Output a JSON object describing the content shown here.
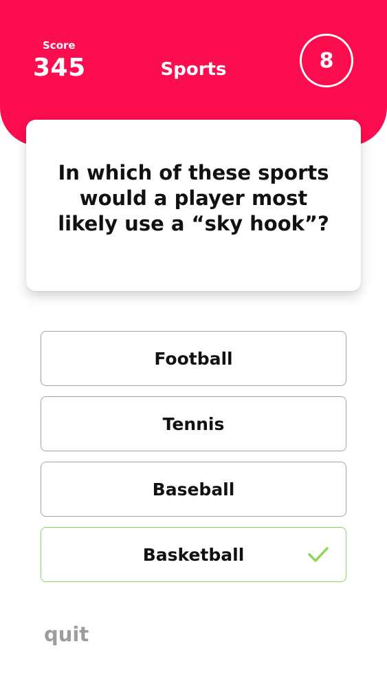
{
  "header": {
    "score_label": "Score",
    "score_value": "345",
    "category": "Sports",
    "timer": "8"
  },
  "question": {
    "text": "In which of these sports would a player most likely use a “sky hook”?"
  },
  "answers": [
    {
      "label": "Football",
      "state": "default"
    },
    {
      "label": "Tennis",
      "state": "default"
    },
    {
      "label": "Baseball",
      "state": "default"
    },
    {
      "label": "Basketball",
      "state": "correct",
      "icon": "check-icon"
    }
  ],
  "footer": {
    "quit_label": "quit"
  },
  "colors": {
    "header_bg": "#fb0d4f",
    "correct_border": "#8ed65a",
    "default_border": "#a3a3a3",
    "quit_text": "#9d9d9d"
  }
}
